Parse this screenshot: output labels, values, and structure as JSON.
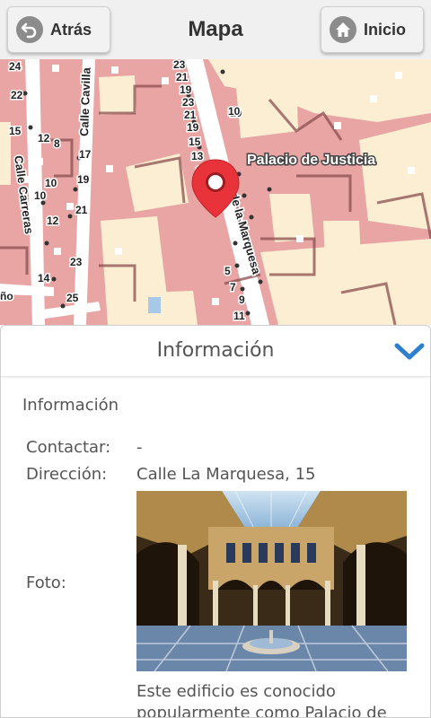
{
  "header": {
    "title": "Mapa",
    "back_label": "Atrás",
    "home_label": "Inicio"
  },
  "map": {
    "place_label": "Palacio de Justicia",
    "street_labels": [
      "Calle Cavilla",
      "Calle Carreras",
      "de la Marquesa"
    ],
    "numbers": [
      "24",
      "22",
      "23",
      "21",
      "19",
      "23",
      "21",
      "19",
      "10",
      "15",
      "13",
      "17",
      "17",
      "15",
      "12",
      "8",
      "17",
      "19",
      "10",
      "21",
      "10",
      "12",
      "14",
      "23",
      "25",
      "5",
      "7",
      "9",
      "11",
      "10",
      "ño"
    ]
  },
  "panel": {
    "header_title": "Información",
    "section_title": "Información",
    "contact_label": "Contactar:",
    "contact_value": "-",
    "address_label": "Dirección:",
    "address_value": "Calle La Marquesa, 15",
    "photo_label": "Foto:",
    "description": "Este edificio es conocido popularmente como Palacio de"
  },
  "colors": {
    "marker": "#e8333a",
    "chevron": "#2f7fd0",
    "building": "#e9a4a4",
    "courtyard": "#fbeed3"
  }
}
